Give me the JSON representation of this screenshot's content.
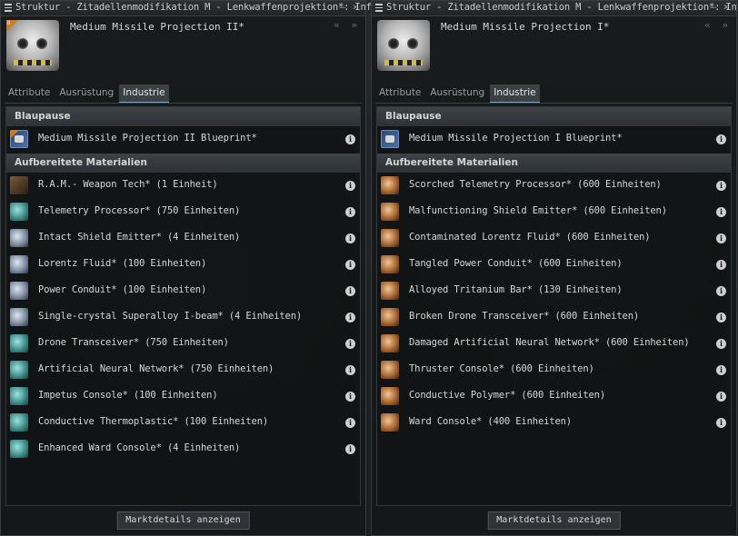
{
  "windows": [
    {
      "title": "Struktur - Zitadellenmodifikation M - Lenkwaffenprojektion*: Info",
      "controls": {
        "minimize": "–",
        "close": "×"
      },
      "tech_badge": "II",
      "item_name": "Medium Missile Projection II*",
      "header_arrows": "« »",
      "tabs": [
        "Attribute",
        "Ausrüstung",
        "Industrie"
      ],
      "active_tab": "Industrie",
      "blueprint_section": "Blaupause",
      "blueprint": "Medium Missile Projection II Blueprint*",
      "materials_section": "Aufbereitete Materialien",
      "materials": [
        {
          "label": "R.A.M.- Weapon Tech* (1 Einheit)",
          "icon": "ram-weapon-tech-icon"
        },
        {
          "label": "Telemetry Processor* (750 Einheiten)",
          "icon": "telemetry-processor-icon"
        },
        {
          "label": "Intact Shield Emitter* (4 Einheiten)",
          "icon": "shield-emitter-icon"
        },
        {
          "label": "Lorentz Fluid* (100 Einheiten)",
          "icon": "lorentz-fluid-icon"
        },
        {
          "label": "Power Conduit* (100 Einheiten)",
          "icon": "power-conduit-icon"
        },
        {
          "label": "Single-crystal Superalloy I-beam* (4 Einheiten)",
          "icon": "i-beam-icon"
        },
        {
          "label": "Drone Transceiver* (750 Einheiten)",
          "icon": "drone-transceiver-icon"
        },
        {
          "label": "Artificial Neural Network* (750 Einheiten)",
          "icon": "neural-network-icon"
        },
        {
          "label": "Impetus Console* (100 Einheiten)",
          "icon": "impetus-console-icon"
        },
        {
          "label": "Conductive Thermoplastic* (100 Einheiten)",
          "icon": "thermoplastic-icon"
        },
        {
          "label": "Enhanced Ward Console* (4 Einheiten)",
          "icon": "ward-console-icon"
        }
      ],
      "market_button": "Marktdetails anzeigen"
    },
    {
      "title": "Struktur - Zitadellenmodifikation M - Lenkwaffenprojektion*: Info",
      "controls": {
        "minimize": "–",
        "close": "×"
      },
      "tech_badge": "",
      "item_name": "Medium Missile Projection I*",
      "header_arrows": "« »",
      "tabs": [
        "Attribute",
        "Ausrüstung",
        "Industrie"
      ],
      "active_tab": "Industrie",
      "blueprint_section": "Blaupause",
      "blueprint": "Medium Missile Projection I Blueprint*",
      "materials_section": "Aufbereitete Materialien",
      "materials": [
        {
          "label": "Scorched Telemetry Processor* (600 Einheiten)",
          "icon": "scorched-telemetry-processor-icon"
        },
        {
          "label": "Malfunctioning Shield Emitter* (600 Einheiten)",
          "icon": "malfunctioning-shield-emitter-icon"
        },
        {
          "label": "Contaminated Lorentz Fluid* (600 Einheiten)",
          "icon": "contaminated-lorentz-fluid-icon"
        },
        {
          "label": "Tangled Power Conduit* (600 Einheiten)",
          "icon": "tangled-power-conduit-icon"
        },
        {
          "label": "Alloyed Tritanium Bar* (130 Einheiten)",
          "icon": "tritanium-bar-icon"
        },
        {
          "label": "Broken Drone Transceiver* (600 Einheiten)",
          "icon": "broken-drone-transceiver-icon"
        },
        {
          "label": "Damaged Artificial Neural Network* (600 Einheiten)",
          "icon": "damaged-neural-network-icon"
        },
        {
          "label": "Thruster Console* (600 Einheiten)",
          "icon": "thruster-console-icon"
        },
        {
          "label": "Conductive Polymer* (600 Einheiten)",
          "icon": "conductive-polymer-icon"
        },
        {
          "label": "Ward Console* (400 Einheiten)",
          "icon": "ward-console-icon"
        }
      ],
      "market_button": "Marktdetails anzeigen"
    }
  ],
  "info_glyph": "i"
}
